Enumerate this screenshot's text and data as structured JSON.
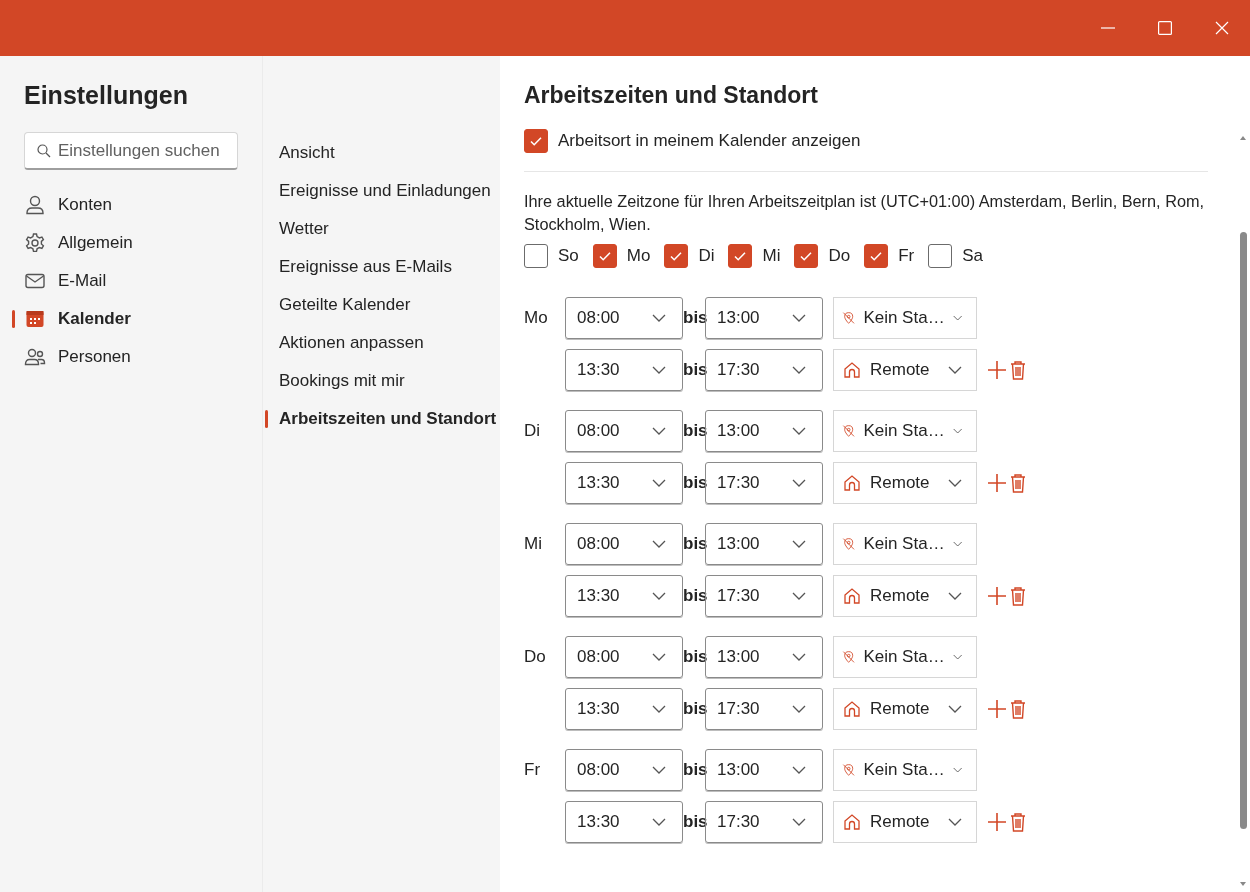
{
  "sidebar": {
    "title": "Einstellungen",
    "search": {
      "placeholder": "Einstellungen suchen"
    },
    "items": [
      {
        "kind": "accounts",
        "label": "Konten",
        "selected": false
      },
      {
        "kind": "general",
        "label": "Allgemein",
        "selected": false
      },
      {
        "kind": "mail",
        "label": "E-Mail",
        "selected": false
      },
      {
        "kind": "calendar",
        "label": "Kalender",
        "selected": true
      },
      {
        "kind": "people",
        "label": "Personen",
        "selected": false
      }
    ]
  },
  "subnav": {
    "items": [
      {
        "label": "Ansicht",
        "selected": false
      },
      {
        "label": "Ereignisse und Einladungen",
        "selected": false
      },
      {
        "label": "Wetter",
        "selected": false
      },
      {
        "label": "Ereignisse aus E-Mails",
        "selected": false
      },
      {
        "label": "Geteilte Kalender",
        "selected": false
      },
      {
        "label": "Aktionen anpassen",
        "selected": false
      },
      {
        "label": "Bookings mit mir",
        "selected": false
      },
      {
        "label": "Arbeitszeiten und Standort",
        "selected": true
      }
    ]
  },
  "content": {
    "title": "Arbeitszeiten und Standort",
    "show_location": {
      "label": "Arbeitsort in meinem Kalender anzeigen",
      "checked": true
    },
    "timezone_note": "Ihre aktuelle Zeitzone für Ihren Arbeitszeitplan ist (UTC+01:00) Amsterdam, Berlin, Bern, Rom, Stockholm, Wien.",
    "days": [
      {
        "label": "So",
        "checked": false
      },
      {
        "label": "Mo",
        "checked": true
      },
      {
        "label": "Di",
        "checked": true
      },
      {
        "label": "Mi",
        "checked": true
      },
      {
        "label": "Do",
        "checked": true
      },
      {
        "label": "Fr",
        "checked": true
      },
      {
        "label": "Sa",
        "checked": false
      }
    ],
    "schedule": [
      {
        "day": "Mo",
        "slots": [
          {
            "start": "08:00",
            "separator": "bis",
            "end": "13:00",
            "location": {
              "kind": "none",
              "label": "Kein Sta…"
            },
            "removable": false
          },
          {
            "start": "13:30",
            "separator": "bis",
            "end": "17:30",
            "location": {
              "kind": "remote",
              "label": "Remote"
            },
            "removable": true
          }
        ]
      },
      {
        "day": "Di",
        "slots": [
          {
            "start": "08:00",
            "separator": "bis",
            "end": "13:00",
            "location": {
              "kind": "none",
              "label": "Kein Sta…"
            },
            "removable": false
          },
          {
            "start": "13:30",
            "separator": "bis",
            "end": "17:30",
            "location": {
              "kind": "remote",
              "label": "Remote"
            },
            "removable": true
          }
        ]
      },
      {
        "day": "Mi",
        "slots": [
          {
            "start": "08:00",
            "separator": "bis",
            "end": "13:00",
            "location": {
              "kind": "none",
              "label": "Kein Sta…"
            },
            "removable": false
          },
          {
            "start": "13:30",
            "separator": "bis",
            "end": "17:30",
            "location": {
              "kind": "remote",
              "label": "Remote"
            },
            "removable": true
          }
        ]
      },
      {
        "day": "Do",
        "slots": [
          {
            "start": "08:00",
            "separator": "bis",
            "end": "13:00",
            "location": {
              "kind": "none",
              "label": "Kein Sta…"
            },
            "removable": false
          },
          {
            "start": "13:30",
            "separator": "bis",
            "end": "17:30",
            "location": {
              "kind": "remote",
              "label": "Remote"
            },
            "removable": true
          }
        ]
      },
      {
        "day": "Fr",
        "slots": [
          {
            "start": "08:00",
            "separator": "bis",
            "end": "13:00",
            "location": {
              "kind": "none",
              "label": "Kein Sta…"
            },
            "removable": false
          },
          {
            "start": "13:30",
            "separator": "bis",
            "end": "17:30",
            "location": {
              "kind": "remote",
              "label": "Remote"
            },
            "removable": true
          }
        ]
      }
    ]
  }
}
